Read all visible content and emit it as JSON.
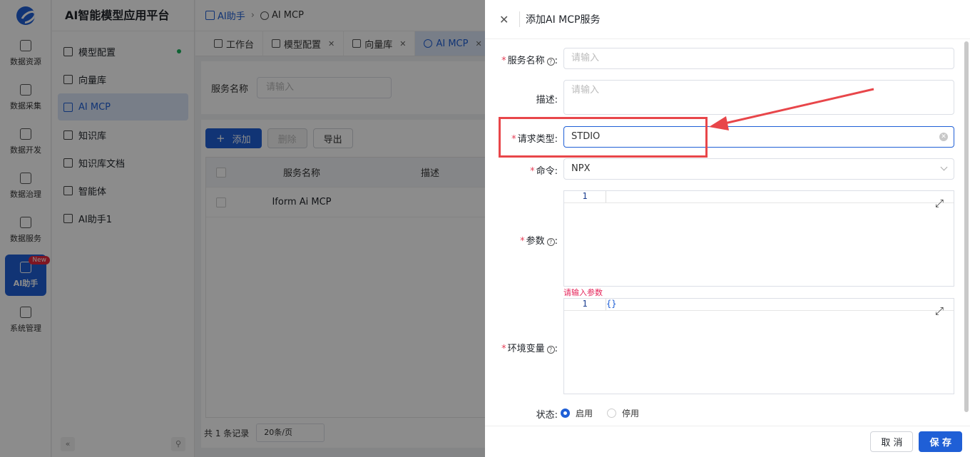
{
  "rail": {
    "items": [
      {
        "label": "数据资源",
        "icon": "data-resource-icon"
      },
      {
        "label": "数据采集",
        "icon": "data-collect-icon"
      },
      {
        "label": "数据开发",
        "icon": "data-dev-icon"
      },
      {
        "label": "数据治理",
        "icon": "layers-icon"
      },
      {
        "label": "数据服务",
        "icon": "data-service-icon"
      },
      {
        "label": "AI助手",
        "icon": "ai-icon",
        "badge": "New"
      },
      {
        "label": "系统管理",
        "icon": "grid-icon"
      }
    ]
  },
  "sidebar": {
    "title": "AI智能模型应用平台",
    "items": [
      {
        "label": "模型配置"
      },
      {
        "label": "向量库"
      },
      {
        "label": "AI MCP"
      },
      {
        "label": "知识库"
      },
      {
        "label": "知识库文档"
      },
      {
        "label": "智能体"
      },
      {
        "label": "AI助手1"
      }
    ]
  },
  "breadcrumb": {
    "root": "AI助手",
    "current": "AI MCP"
  },
  "tabs": [
    {
      "label": "工作台"
    },
    {
      "label": "模型配置"
    },
    {
      "label": "向量库"
    },
    {
      "label": "AI MCP"
    }
  ],
  "search": {
    "label": "服务名称",
    "placeholder": "请输入"
  },
  "toolbar": {
    "add": "添加",
    "delete": "删除",
    "export": "导出"
  },
  "table": {
    "headers": [
      "服务名称",
      "描述"
    ],
    "rows": [
      {
        "name": "Iform Ai MCP"
      }
    ]
  },
  "pager": {
    "total": "共 1 条记录",
    "page_size": "20条/页"
  },
  "drawer": {
    "title": "添加AI MCP服务",
    "fields": {
      "name_label": "服务名称",
      "name_placeholder": "请输入",
      "desc_label": "描述:",
      "desc_placeholder": "请输入",
      "type_label": "请求类型:",
      "type_value": "STDIO",
      "cmd_label": "命令:",
      "cmd_value": "NPX",
      "params_label": "参数",
      "params_line": "1",
      "params_error": "请输入参数",
      "env_label": "环境变量",
      "env_line": "1",
      "env_value": "{}",
      "status_label": "状态:",
      "status_on": "启用",
      "status_off": "停用"
    },
    "cancel": "取 消",
    "save": "保 存"
  },
  "colors": {
    "primary": "#1f5fd6",
    "required": "#e53e56",
    "annotation": "#e8464a"
  }
}
